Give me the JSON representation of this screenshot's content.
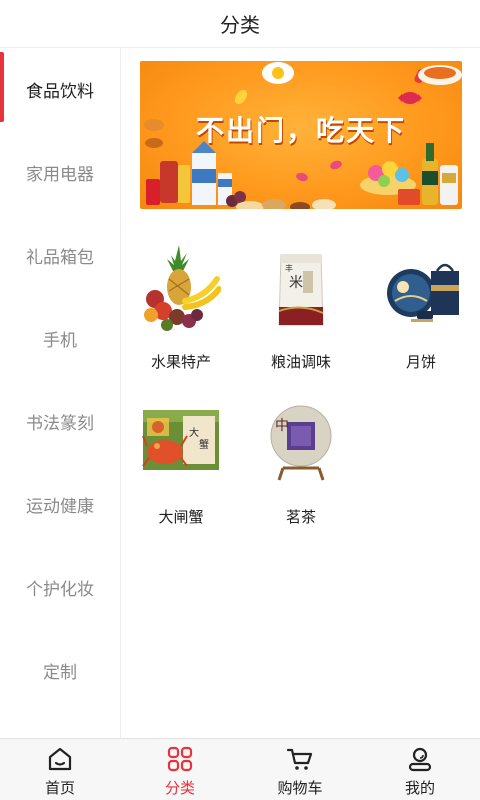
{
  "header": {
    "title": "分类"
  },
  "sidebar": {
    "items": [
      {
        "label": "食品饮料",
        "active": true
      },
      {
        "label": "家用电器",
        "active": false
      },
      {
        "label": "礼品箱包",
        "active": false
      },
      {
        "label": "手机",
        "active": false
      },
      {
        "label": "书法篆刻",
        "active": false
      },
      {
        "label": "运动健康",
        "active": false
      },
      {
        "label": "个护化妆",
        "active": false
      },
      {
        "label": "定制",
        "active": false
      }
    ]
  },
  "banner": {
    "text": "不出门，吃天下"
  },
  "categories": [
    {
      "label": "水果特产",
      "icon": "fruit-basket"
    },
    {
      "label": "粮油调味",
      "icon": "rice-bag"
    },
    {
      "label": "月饼",
      "icon": "mooncake-gift-box"
    },
    {
      "label": "大闸蟹",
      "icon": "crab-gift-box"
    },
    {
      "label": "茗茶",
      "icon": "tea-cake"
    }
  ],
  "tabbar": {
    "items": [
      {
        "label": "首页",
        "icon": "home-icon",
        "active": false
      },
      {
        "label": "分类",
        "icon": "category-icon",
        "active": true
      },
      {
        "label": "购物车",
        "icon": "cart-icon",
        "active": false
      },
      {
        "label": "我的",
        "icon": "user-icon",
        "active": false
      }
    ]
  },
  "colors": {
    "accent": "#e8323c",
    "banner_orange": "#ff9a1e",
    "inactive_text": "#8a8a8a"
  }
}
